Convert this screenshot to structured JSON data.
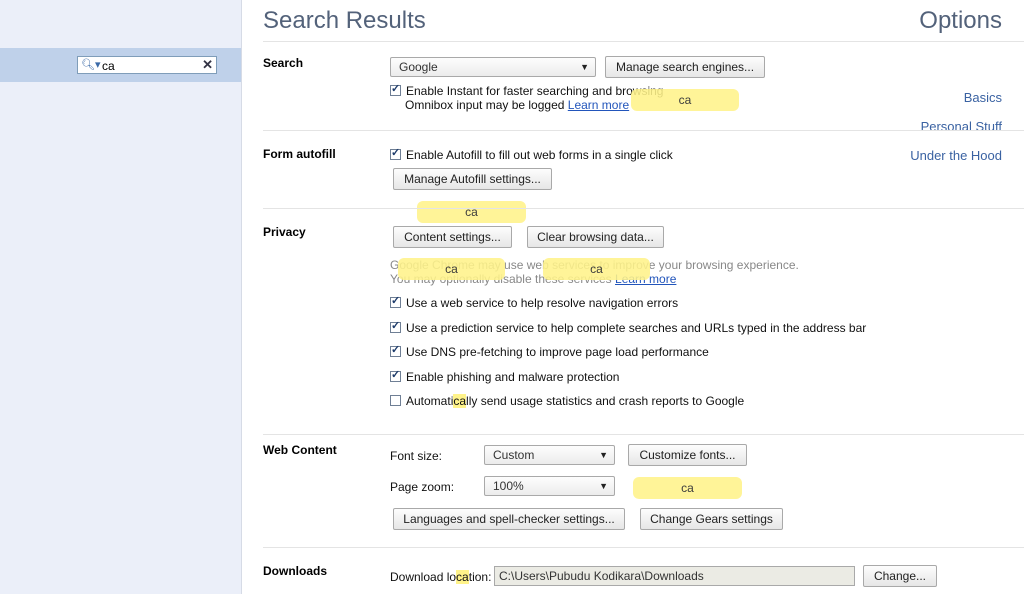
{
  "sidebar": {
    "title": "Options",
    "search": {
      "value": "ca"
    },
    "items": [
      {
        "label": "Basics"
      },
      {
        "label": "Personal Stuff"
      },
      {
        "label": "Under the Hood"
      }
    ]
  },
  "main": {
    "title": "Search Results"
  },
  "sections": {
    "search": {
      "label": "Search",
      "engine": "Google",
      "manage_btn": "Manage search engines...",
      "instant_text": "Enable Instant for faster searching and browsing",
      "instant_checked": true,
      "omnibox_text": "Omnibox input may be logged",
      "learn_more": "Learn more"
    },
    "autofill": {
      "label": "Form autofill",
      "enable_text": "Enable Autofill to fill out web forms in a single click",
      "enable_checked": true,
      "manage_btn": "Manage Autofill settings..."
    },
    "privacy": {
      "label": "Privacy",
      "content_btn": "Content settings...",
      "clear_btn": "Clear browsing data...",
      "info_line1": "Google Chrome may use web services to improve your browsing experience.",
      "info_line2": "You may optionally disable these services",
      "learn_more": "Learn more",
      "options": [
        {
          "label": "Use a web service to help resolve navigation errors",
          "checked": true
        },
        {
          "label": "Use a prediction service to help complete searches and URLs typed in the address bar",
          "checked": true
        },
        {
          "label": "Use DNS pre-fetching to improve page load performance",
          "checked": true
        },
        {
          "label": "Enable phishing and malware protection",
          "checked": true
        }
      ],
      "usage_pre": "Automati",
      "usage_hl": "ca",
      "usage_post": "lly send usage statistics and crash reports to Google",
      "usage_checked": false
    },
    "webcontent": {
      "label": "Web Content",
      "font_size_label": "Font size:",
      "font_size_value": "Custom",
      "customize_btn": "Customize fonts...",
      "zoom_label": "Page zoom:",
      "zoom_value": "100%",
      "languages_btn": "Languages and spell-checker settings...",
      "gears_btn": "Change Gears settings"
    },
    "downloads": {
      "label": "Downloads",
      "loc_pre": "Download lo",
      "loc_hl": "ca",
      "loc_post": "tion:",
      "path": "C:\\Users\\Pubudu Kodikara\\Downloads",
      "change_btn": "Change..."
    }
  },
  "bubble_text": "ca",
  "colors": {
    "sidebar_bg": "#ebeff9",
    "highlight": "#fff38a",
    "link": "#2255bb",
    "title": "#53627a"
  }
}
